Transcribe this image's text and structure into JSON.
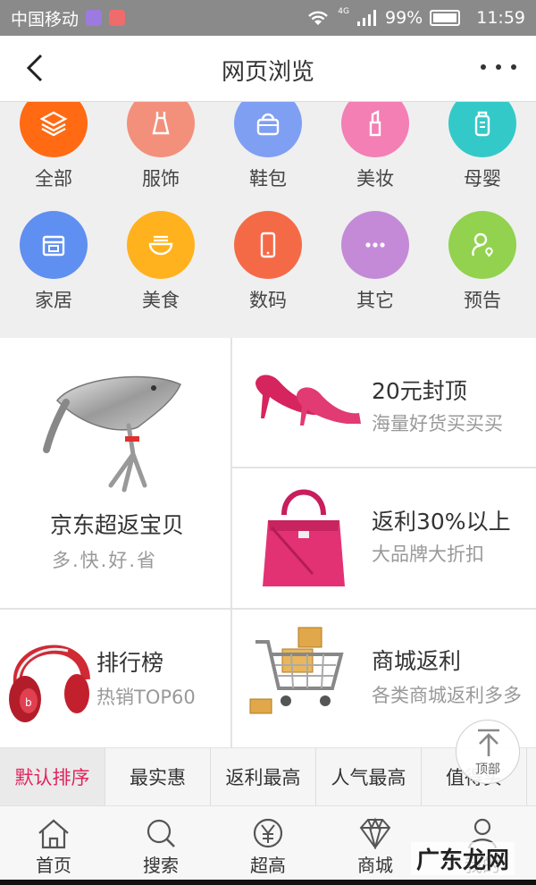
{
  "status_bar": {
    "carrier": "中国移动",
    "network": "4G",
    "battery": "99%",
    "time": "11:59"
  },
  "header": {
    "title": "网页浏览",
    "back_icon": "back-arrow-icon",
    "more_icon": "more-dots-icon"
  },
  "categories": [
    {
      "label": "全部",
      "icon": "layers-icon",
      "color": "#ff6a13"
    },
    {
      "label": "服饰",
      "icon": "dress-icon",
      "color": "#f2907c"
    },
    {
      "label": "鞋包",
      "icon": "handbag-icon",
      "color": "#7f9ff3"
    },
    {
      "label": "美妆",
      "icon": "lipstick-icon",
      "color": "#f37fb4"
    },
    {
      "label": "母婴",
      "icon": "baby-bottle-icon",
      "color": "#33c9c9"
    },
    {
      "label": "家居",
      "icon": "home-box-icon",
      "color": "#5f8ff0"
    },
    {
      "label": "美食",
      "icon": "noodle-bowl-icon",
      "color": "#ffb21d"
    },
    {
      "label": "数码",
      "icon": "phone-icon",
      "color": "#f46a47"
    },
    {
      "label": "其它",
      "icon": "ellipsis-icon",
      "color": "#c48ad7"
    },
    {
      "label": "预告",
      "icon": "forecast-icon",
      "color": "#92d24f"
    }
  ],
  "promos": {
    "jd": {
      "title": "京东超返宝贝",
      "subtitle": "多.快.好.省"
    },
    "cap20": {
      "title": "20元封顶",
      "subtitle": "海量好货买买买"
    },
    "rebate30": {
      "title": "返利30%以上",
      "subtitle": "大品牌大折扣"
    },
    "ranking": {
      "title": "排行榜",
      "subtitle": "热销TOP60"
    },
    "mall": {
      "title": "商城返利",
      "subtitle": "各类商城返利多多"
    }
  },
  "sort_tabs": [
    {
      "label": "默认排序"
    },
    {
      "label": "最实惠"
    },
    {
      "label": "返利最高"
    },
    {
      "label": "人气最高"
    },
    {
      "label": "值得买"
    }
  ],
  "back_to_top": {
    "label": "顶部"
  },
  "bottom_nav": [
    {
      "label": "首页",
      "icon": "home-icon"
    },
    {
      "label": "搜索",
      "icon": "search-icon"
    },
    {
      "label": "超高",
      "icon": "yen-coin-icon"
    },
    {
      "label": "商城",
      "icon": "diamond-icon"
    },
    {
      "label": "我的",
      "icon": "person-icon"
    }
  ],
  "watermark": "广东龙网",
  "colors": {
    "accent": "#e0245e",
    "status_bar": "#8a8a8a"
  }
}
